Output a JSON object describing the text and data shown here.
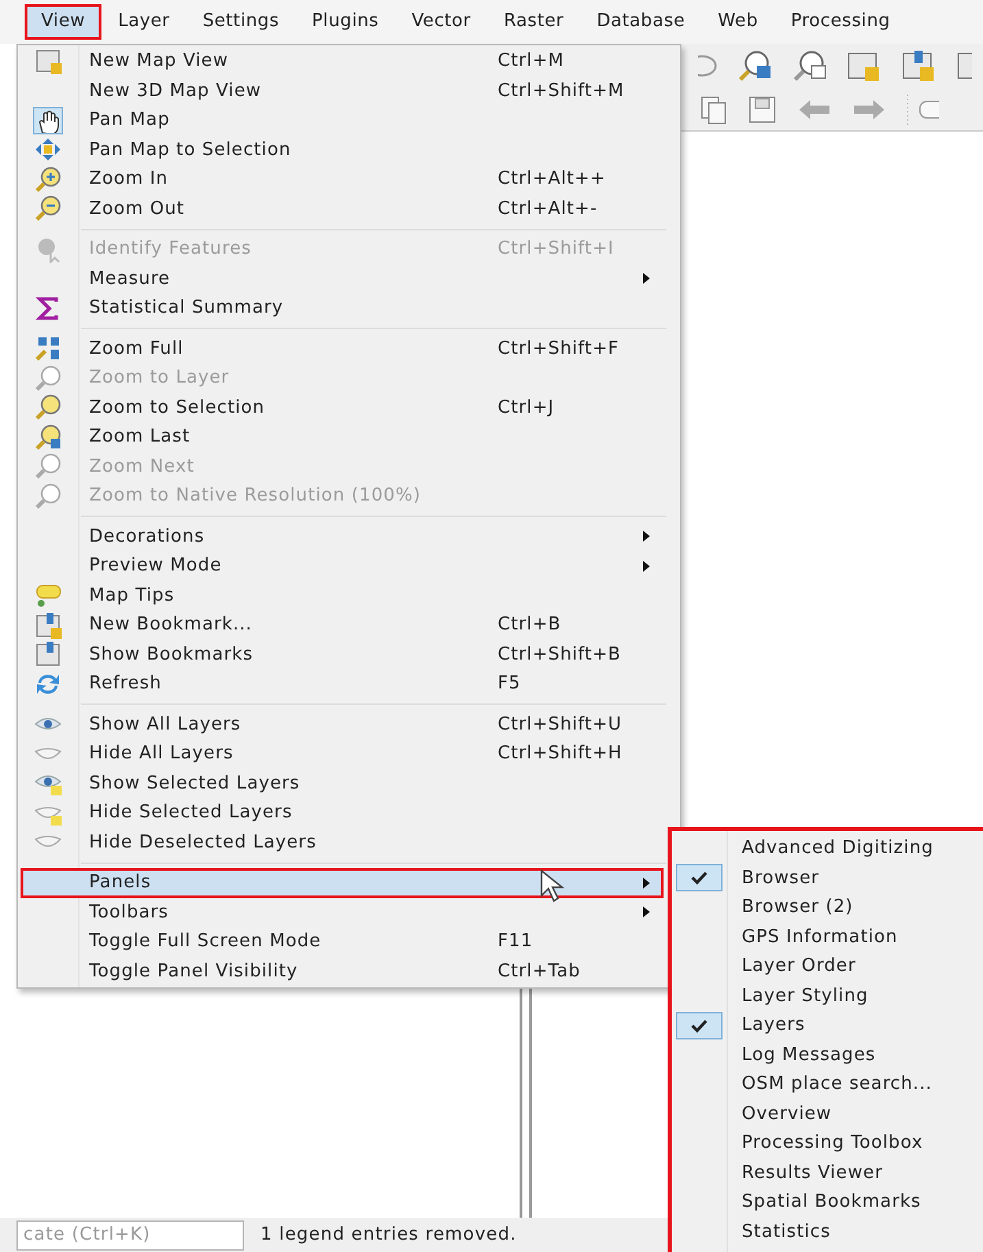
{
  "menubar": [
    {
      "label": "View",
      "selected": true
    },
    {
      "label": "Layer",
      "selected": false
    },
    {
      "label": "Settings",
      "selected": false
    },
    {
      "label": "Plugins",
      "selected": false
    },
    {
      "label": "Vector",
      "selected": false
    },
    {
      "label": "Raster",
      "selected": false
    },
    {
      "label": "Database",
      "selected": false
    },
    {
      "label": "Web",
      "selected": false
    },
    {
      "label": "Processing",
      "selected": false
    }
  ],
  "view_menu": {
    "sections": [
      [
        {
          "label": "New Map View",
          "shortcut": "Ctrl+M",
          "disabled": false,
          "submenu": false,
          "checked": false,
          "highlighted": false
        },
        {
          "label": "New 3D Map View",
          "shortcut": "Ctrl+Shift+M",
          "disabled": false,
          "submenu": false,
          "checked": false,
          "highlighted": false
        },
        {
          "label": "Pan Map",
          "disabled": false,
          "submenu": false,
          "checked": true,
          "highlighted": false
        },
        {
          "label": "Pan Map to Selection",
          "disabled": false,
          "submenu": false,
          "checked": false,
          "highlighted": false
        },
        {
          "label": "Zoom In",
          "shortcut": "Ctrl+Alt++",
          "disabled": false,
          "submenu": false,
          "checked": false,
          "highlighted": false
        },
        {
          "label": "Zoom Out",
          "shortcut": "Ctrl+Alt+-",
          "disabled": false,
          "submenu": false,
          "checked": false,
          "highlighted": false
        }
      ],
      [
        {
          "label": "Identify Features",
          "shortcut": "Ctrl+Shift+I",
          "disabled": true,
          "submenu": false,
          "checked": false,
          "highlighted": false
        },
        {
          "label": "Measure",
          "disabled": false,
          "submenu": true,
          "checked": false,
          "highlighted": false
        },
        {
          "label": "Statistical Summary",
          "disabled": false,
          "submenu": false,
          "checked": false,
          "highlighted": false
        }
      ],
      [
        {
          "label": "Zoom Full",
          "shortcut": "Ctrl+Shift+F",
          "disabled": false,
          "submenu": false,
          "checked": false,
          "highlighted": false
        },
        {
          "label": "Zoom to Layer",
          "disabled": true,
          "submenu": false,
          "checked": false,
          "highlighted": false
        },
        {
          "label": "Zoom to Selection",
          "shortcut": "Ctrl+J",
          "disabled": false,
          "submenu": false,
          "checked": false,
          "highlighted": false
        },
        {
          "label": "Zoom Last",
          "disabled": false,
          "submenu": false,
          "checked": false,
          "highlighted": false
        },
        {
          "label": "Zoom Next",
          "disabled": true,
          "submenu": false,
          "checked": false,
          "highlighted": false
        },
        {
          "label": "Zoom to Native Resolution (100%)",
          "disabled": true,
          "submenu": false,
          "checked": false,
          "highlighted": false
        }
      ],
      [
        {
          "label": "Decorations",
          "disabled": false,
          "submenu": true,
          "checked": false,
          "highlighted": false
        },
        {
          "label": "Preview Mode",
          "disabled": false,
          "submenu": true,
          "checked": false,
          "highlighted": false
        },
        {
          "label": "Map Tips",
          "disabled": false,
          "submenu": false,
          "checked": false,
          "highlighted": false
        },
        {
          "label": "New Bookmark...",
          "shortcut": "Ctrl+B",
          "disabled": false,
          "submenu": false,
          "checked": false,
          "highlighted": false
        },
        {
          "label": "Show Bookmarks",
          "shortcut": "Ctrl+Shift+B",
          "disabled": false,
          "submenu": false,
          "checked": false,
          "highlighted": false
        },
        {
          "label": "Refresh",
          "shortcut": "F5",
          "disabled": false,
          "submenu": false,
          "checked": false,
          "highlighted": false
        }
      ],
      [
        {
          "label": "Show All Layers",
          "shortcut": "Ctrl+Shift+U",
          "disabled": false,
          "submenu": false,
          "checked": false,
          "highlighted": false
        },
        {
          "label": "Hide All Layers",
          "shortcut": "Ctrl+Shift+H",
          "disabled": false,
          "submenu": false,
          "checked": false,
          "highlighted": false
        },
        {
          "label": "Show Selected Layers",
          "disabled": false,
          "submenu": false,
          "checked": false,
          "highlighted": false
        },
        {
          "label": "Hide Selected Layers",
          "disabled": false,
          "submenu": false,
          "checked": false,
          "highlighted": false
        },
        {
          "label": "Hide Deselected Layers",
          "disabled": false,
          "submenu": false,
          "checked": false,
          "highlighted": false
        }
      ],
      [
        {
          "label": "Panels",
          "disabled": false,
          "submenu": true,
          "checked": false,
          "highlighted": true
        },
        {
          "label": "Toolbars",
          "disabled": false,
          "submenu": true,
          "checked": false,
          "highlighted": false
        },
        {
          "label": "Toggle Full Screen Mode",
          "shortcut": "F11",
          "disabled": false,
          "submenu": false,
          "checked": false,
          "highlighted": false
        },
        {
          "label": "Toggle Panel Visibility",
          "shortcut": "Ctrl+Tab",
          "disabled": false,
          "submenu": false,
          "checked": false,
          "highlighted": false
        }
      ]
    ]
  },
  "panels_submenu": {
    "items": [
      {
        "label": "Advanced Digitizing",
        "checked": false
      },
      {
        "label": "Browser",
        "checked": true
      },
      {
        "label": "Browser (2)",
        "checked": false
      },
      {
        "label": "GPS Information",
        "checked": false
      },
      {
        "label": "Layer Order",
        "checked": false
      },
      {
        "label": "Layer Styling",
        "checked": false
      },
      {
        "label": "Layers",
        "checked": true
      },
      {
        "label": "Log Messages",
        "checked": false
      },
      {
        "label": "OSM place search...",
        "checked": false
      },
      {
        "label": "Overview",
        "checked": false
      },
      {
        "label": "Processing Toolbox",
        "checked": false
      },
      {
        "label": "Results Viewer",
        "checked": false
      },
      {
        "label": "Spatial Bookmarks",
        "checked": false
      },
      {
        "label": "Statistics",
        "checked": false
      }
    ]
  },
  "status_bar": {
    "locator": {
      "placeholder": "cate (Ctrl+K)"
    },
    "message": "1 legend entries removed."
  }
}
